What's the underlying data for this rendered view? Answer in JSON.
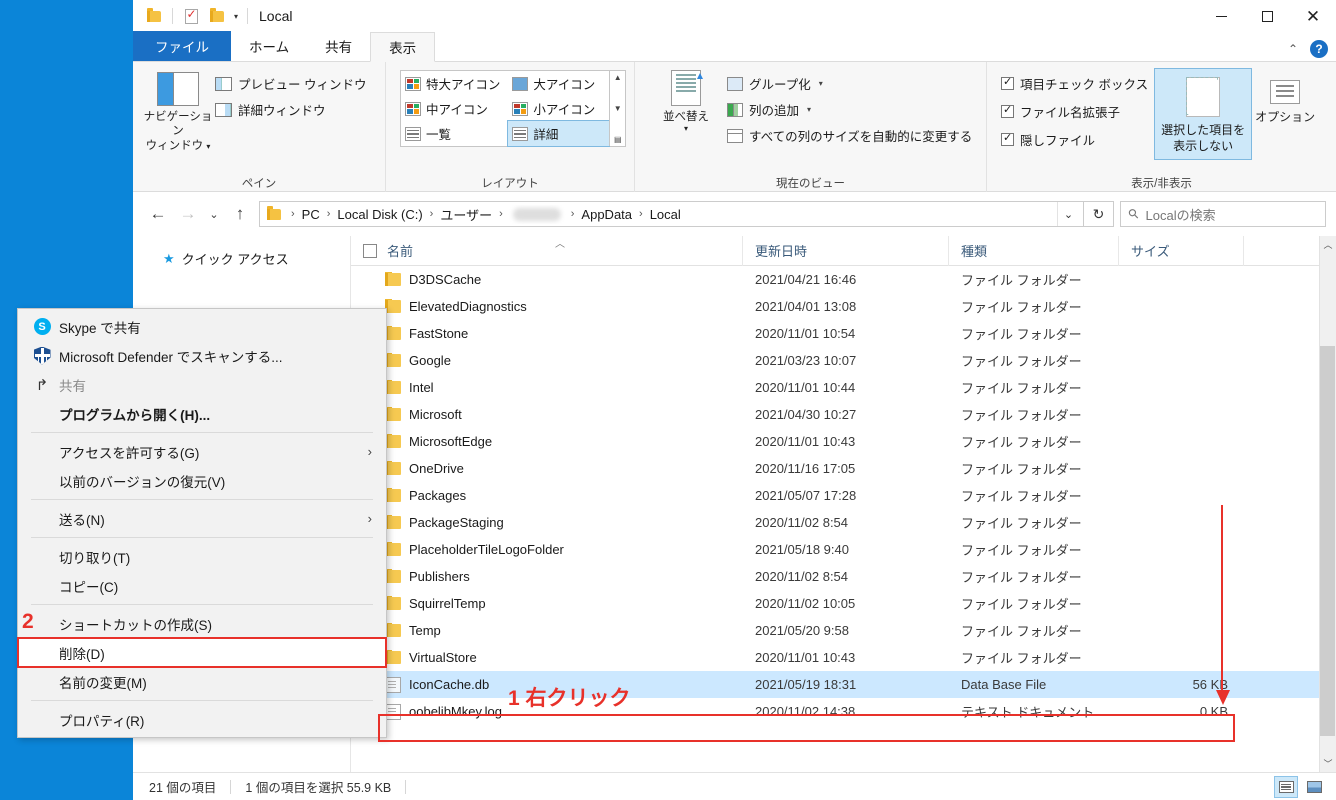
{
  "window": {
    "title": "Local",
    "quick_access_icons": [
      "folder-icon",
      "check-document-icon",
      "folder-icon",
      "dropdown-caret-icon"
    ],
    "controls": {
      "minimize": "−",
      "maximize": "□",
      "close": "✕"
    },
    "ribbon_collapse": "⌃",
    "help": "?"
  },
  "tabs": [
    {
      "label": "ファイル",
      "kind": "file"
    },
    {
      "label": "ホーム",
      "kind": "normal"
    },
    {
      "label": "共有",
      "kind": "normal"
    },
    {
      "label": "表示",
      "kind": "active"
    }
  ],
  "ribbon": {
    "groups": [
      {
        "label": "ペイン",
        "big_button": "ナビゲーション\nウィンドウ",
        "big_button_line1": "ナビゲーション",
        "big_button_line2": "ウィンドウ",
        "items": [
          {
            "label": "プレビュー ウィンドウ",
            "icon": "preview-pane-icon"
          },
          {
            "label": "詳細ウィンドウ",
            "icon": "details-pane-icon"
          }
        ]
      },
      {
        "label": "レイアウト",
        "gallery": [
          {
            "label": "特大アイコン",
            "selected": false
          },
          {
            "label": "大アイコン",
            "selected": false
          },
          {
            "label": "中アイコン",
            "selected": false
          },
          {
            "label": "小アイコン",
            "selected": false
          },
          {
            "label": "一覧",
            "selected": false
          },
          {
            "label": "詳細",
            "selected": true
          }
        ]
      },
      {
        "label": "現在のビュー",
        "sort_button_line1": "並べ替え",
        "items": [
          {
            "label": "グループ化",
            "has_caret": true,
            "icon": "group-icon"
          },
          {
            "label": "列の追加",
            "has_caret": true,
            "icon": "add-column-icon"
          },
          {
            "label": "すべての列のサイズを自動的に変更する",
            "has_caret": false,
            "icon": "autosize-columns-icon"
          }
        ]
      },
      {
        "label": "表示/非表示",
        "checkboxes": [
          {
            "label": "項目チェック ボックス",
            "checked": true
          },
          {
            "label": "ファイル名拡張子",
            "checked": true
          },
          {
            "label": "隠しファイル",
            "checked": true
          }
        ],
        "hide_button_line1": "選択した項目を",
        "hide_button_line2": "表示しない",
        "options_button": "オプション"
      }
    ]
  },
  "address": {
    "back": "←",
    "forward": "→",
    "recent_caret": "⌄",
    "up": "↑",
    "breadcrumbs": [
      "PC",
      "Local Disk (C:)",
      "ユーザー",
      "__REDACTED__",
      "AppData",
      "Local"
    ],
    "dropdown_caret": "⌄",
    "refresh": "↻",
    "search_placeholder": "Localの検索",
    "search_value": ""
  },
  "nav_pane": {
    "items": [
      {
        "label": "クイック アクセス",
        "icon": "star-icon"
      }
    ]
  },
  "columns": [
    {
      "key": "name",
      "label": "名前",
      "sorted": true
    },
    {
      "key": "date",
      "label": "更新日時",
      "sorted": false
    },
    {
      "key": "type",
      "label": "種類",
      "sorted": false
    },
    {
      "key": "size",
      "label": "サイズ",
      "sorted": false
    }
  ],
  "files": [
    {
      "name": "D3DSCache",
      "date": "2021/04/21 16:46",
      "type": "ファイル フォルダー",
      "size": "",
      "icon": "folder-icon",
      "selected": false
    },
    {
      "name": "ElevatedDiagnostics",
      "date": "2021/04/01 13:08",
      "type": "ファイル フォルダー",
      "size": "",
      "icon": "folder-icon",
      "selected": false
    },
    {
      "name": "FastStone",
      "date": "2020/11/01 10:54",
      "type": "ファイル フォルダー",
      "size": "",
      "icon": "folder-icon",
      "selected": false
    },
    {
      "name": "Google",
      "date": "2021/03/23 10:07",
      "type": "ファイル フォルダー",
      "size": "",
      "icon": "folder-icon",
      "selected": false
    },
    {
      "name": "Intel",
      "date": "2020/11/01 10:44",
      "type": "ファイル フォルダー",
      "size": "",
      "icon": "folder-icon",
      "selected": false
    },
    {
      "name": "Microsoft",
      "date": "2021/04/30 10:27",
      "type": "ファイル フォルダー",
      "size": "",
      "icon": "folder-icon",
      "selected": false
    },
    {
      "name": "MicrosoftEdge",
      "date": "2020/11/01 10:43",
      "type": "ファイル フォルダー",
      "size": "",
      "icon": "folder-icon",
      "selected": false
    },
    {
      "name": "OneDrive",
      "date": "2020/11/16 17:05",
      "type": "ファイル フォルダー",
      "size": "",
      "icon": "folder-icon",
      "selected": false
    },
    {
      "name": "Packages",
      "date": "2021/05/07 17:28",
      "type": "ファイル フォルダー",
      "size": "",
      "icon": "folder-icon",
      "selected": false
    },
    {
      "name": "PackageStaging",
      "date": "2020/11/02 8:54",
      "type": "ファイル フォルダー",
      "size": "",
      "icon": "folder-icon",
      "selected": false
    },
    {
      "name": "PlaceholderTileLogoFolder",
      "date": "2021/05/18 9:40",
      "type": "ファイル フォルダー",
      "size": "",
      "icon": "folder-icon",
      "selected": false
    },
    {
      "name": "Publishers",
      "date": "2020/11/02 8:54",
      "type": "ファイル フォルダー",
      "size": "",
      "icon": "folder-icon",
      "selected": false
    },
    {
      "name": "SquirrelTemp",
      "date": "2020/11/02 10:05",
      "type": "ファイル フォルダー",
      "size": "",
      "icon": "folder-icon",
      "selected": false
    },
    {
      "name": "Temp",
      "date": "2021/05/20 9:58",
      "type": "ファイル フォルダー",
      "size": "",
      "icon": "folder-icon",
      "selected": false
    },
    {
      "name": "VirtualStore",
      "date": "2020/11/01 10:43",
      "type": "ファイル フォルダー",
      "size": "",
      "icon": "folder-icon",
      "selected": false
    },
    {
      "name": "IconCache.db",
      "date": "2021/05/19 18:31",
      "type": "Data Base File",
      "size": "56 KB",
      "icon": "database-file-icon",
      "selected": true
    },
    {
      "name": "oobelibMkey.log",
      "date": "2020/11/02 14:38",
      "type": "テキスト ドキュメント",
      "size": "0 KB",
      "icon": "log-file-icon",
      "selected": false
    }
  ],
  "status": {
    "item_count": "21 個の項目",
    "selection": "1 個の項目を選択  55.9 KB"
  },
  "view_toggles": [
    {
      "name": "details-view",
      "active": true
    },
    {
      "name": "large-icons-view",
      "active": false
    }
  ],
  "context_menu": [
    {
      "label": "Skype で共有",
      "icon": "skype-icon",
      "type": "item"
    },
    {
      "label": "Microsoft Defender でスキャンする...",
      "icon": "shield-icon",
      "type": "item"
    },
    {
      "label": "共有",
      "icon": "share-icon",
      "type": "item",
      "disabled": true
    },
    {
      "label": "プログラムから開く(H)...",
      "icon": "",
      "type": "item",
      "bold": true
    },
    {
      "type": "separator"
    },
    {
      "label": "アクセスを許可する(G)",
      "icon": "",
      "type": "submenu",
      "arrow": "›"
    },
    {
      "label": "以前のバージョンの復元(V)",
      "icon": "",
      "type": "item"
    },
    {
      "type": "separator"
    },
    {
      "label": "送る(N)",
      "icon": "",
      "type": "submenu",
      "arrow": "›"
    },
    {
      "type": "separator"
    },
    {
      "label": "切り取り(T)",
      "icon": "",
      "type": "item"
    },
    {
      "label": "コピー(C)",
      "icon": "",
      "type": "item"
    },
    {
      "type": "separator"
    },
    {
      "label": "ショートカットの作成(S)",
      "icon": "",
      "type": "item"
    },
    {
      "label": "削除(D)",
      "icon": "",
      "type": "item",
      "annotated": true
    },
    {
      "label": "名前の変更(M)",
      "icon": "",
      "type": "item"
    },
    {
      "type": "separator"
    },
    {
      "label": "プロパティ(R)",
      "icon": "",
      "type": "item"
    }
  ],
  "annotations": {
    "step1_label": "1 右クリック",
    "step2_label": "2",
    "accent_color": "#e8312a"
  }
}
